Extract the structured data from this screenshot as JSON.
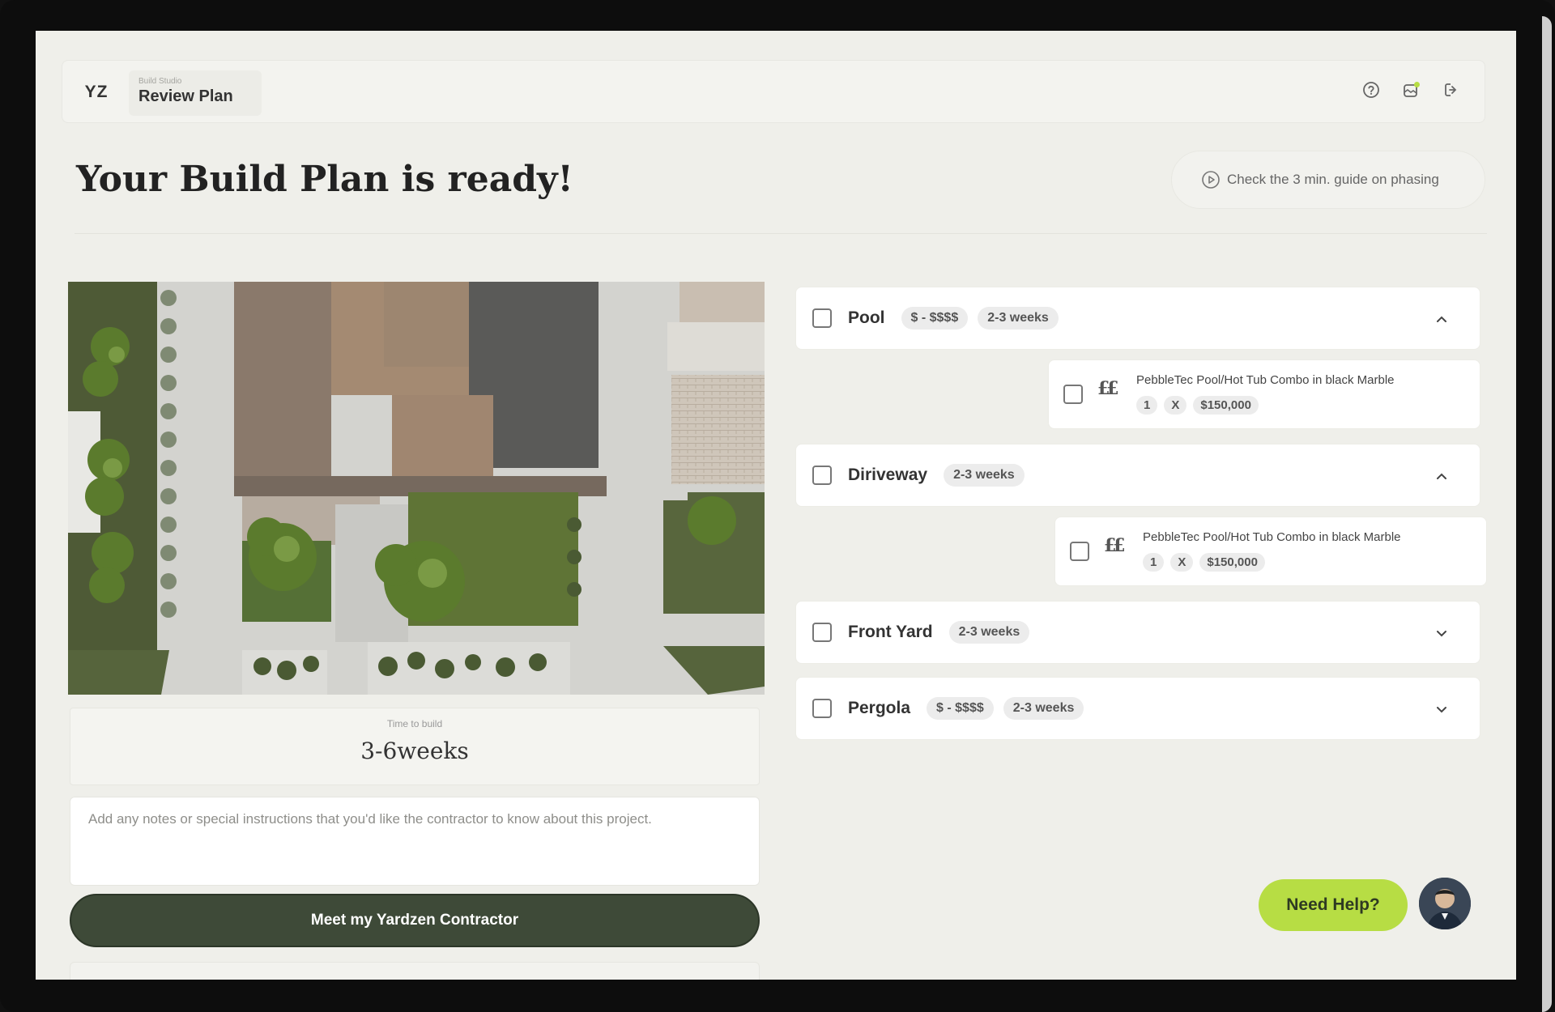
{
  "header": {
    "logo": "YZ",
    "breadcrumb_parent": "Build Studio",
    "breadcrumb_current": "Review Plan",
    "icons": [
      "help-icon",
      "notification-icon",
      "logout-icon"
    ]
  },
  "page": {
    "title": "Your Build Plan is ready!",
    "guide_link": "Check the 3 min. guide on phasing"
  },
  "summary": {
    "time_label": "Time to build",
    "time_value": "3-6weeks"
  },
  "notes": {
    "placeholder": "Add any notes or special instructions that you'd like the contractor to know about this project."
  },
  "cta": {
    "label": "Meet my Yardzen Contractor"
  },
  "sections": [
    {
      "name": "Pool",
      "price": "$ - $$$$",
      "duration": "2-3 weeks",
      "expanded": true,
      "items": [
        {
          "title": "PebbleTec Pool/Hot Tub Combo in black Marble",
          "qty": "1",
          "times": "X",
          "price": "$150,000",
          "icon": "££"
        }
      ]
    },
    {
      "name": "Diriveway",
      "duration": "2-3 weeks",
      "expanded": true,
      "items": [
        {
          "title": "PebbleTec Pool/Hot Tub Combo in black Marble",
          "qty": "1",
          "times": "X",
          "price": "$150,000",
          "icon": "££"
        }
      ]
    },
    {
      "name": "Front Yard",
      "duration": "2-3 weeks",
      "expanded": false
    },
    {
      "name": "Pergola",
      "price": "$ - $$$$",
      "duration": "2-3 weeks",
      "expanded": false
    }
  ],
  "support": {
    "help_label": "Need Help?"
  },
  "colors": {
    "background": "#efefea",
    "cta": "#3e4a38",
    "help": "#b7dd44",
    "card": "#ffffff"
  }
}
